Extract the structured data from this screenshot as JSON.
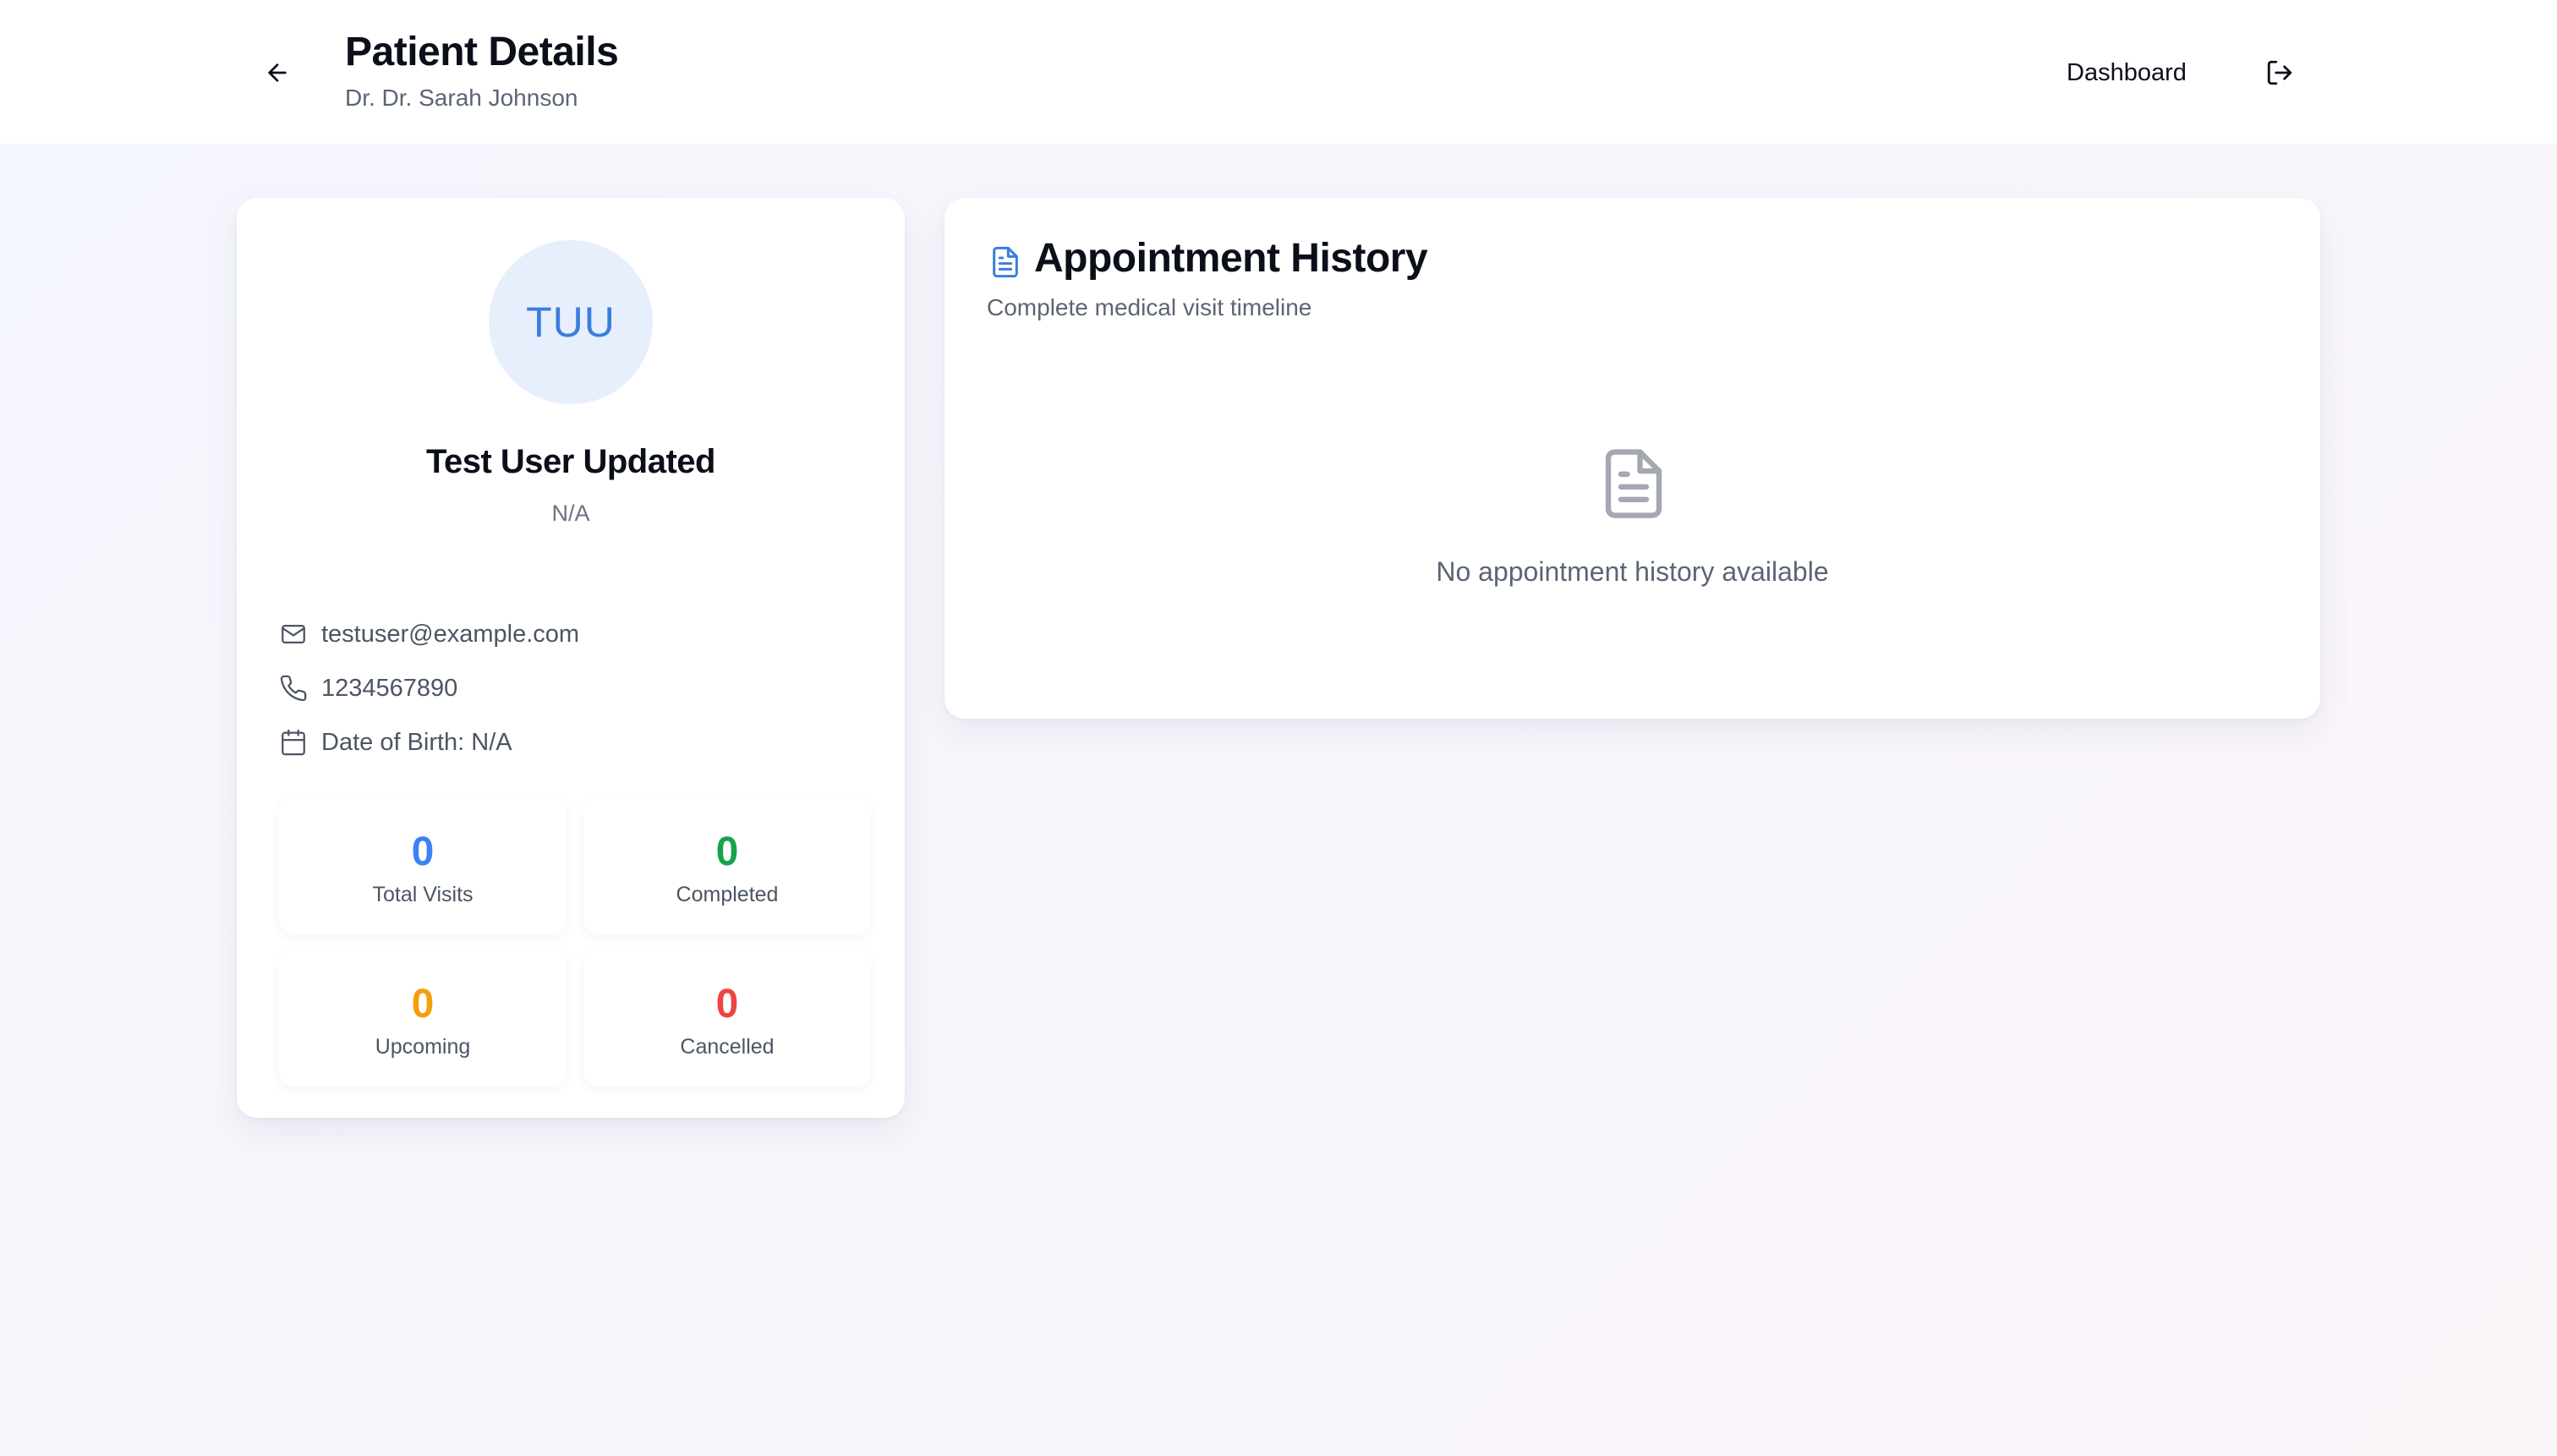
{
  "header": {
    "title": "Patient Details",
    "subtitle": "Dr. Dr. Sarah Johnson",
    "dashboard_label": "Dashboard",
    "back_icon": "arrow-left-icon",
    "logout_icon": "log-out-icon"
  },
  "patient": {
    "initials": "TUU",
    "name": "Test User Updated",
    "gender": "N/A",
    "email": "testuser@example.com",
    "phone": "1234567890",
    "dob": "Date of Birth: N/A"
  },
  "stats": {
    "total": {
      "value": "0",
      "label": "Total Visits",
      "color": "#3b82f6"
    },
    "completed": {
      "value": "0",
      "label": "Completed",
      "color": "#16a34a"
    },
    "upcoming": {
      "value": "0",
      "label": "Upcoming",
      "color": "#f59e0b"
    },
    "cancelled": {
      "value": "0",
      "label": "Cancelled",
      "color": "#ef4444"
    }
  },
  "history": {
    "title": "Appointment History",
    "subtitle": "Complete medical visit timeline",
    "empty_message": "No appointment history available",
    "icon": "file-text-icon"
  },
  "colors": {
    "accent": "#3b7ddd",
    "avatar_bg": "#e7effd"
  }
}
